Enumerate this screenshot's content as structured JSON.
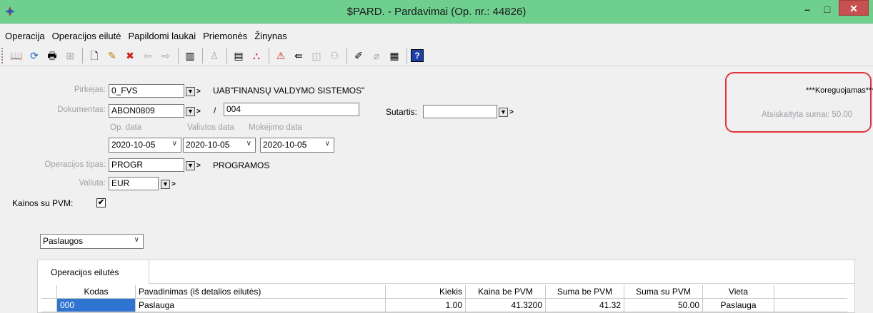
{
  "window": {
    "title": "$PARD. - Pardavimai (Op. nr.: 44826)",
    "min": "–",
    "max": "□",
    "close": "✕"
  },
  "menu": [
    "Operacija",
    "Operacijos eilutė",
    "Papildomi laukai",
    "Priemonės",
    "Žinynas"
  ],
  "form": {
    "buyer_label": "Pirkėjas:",
    "buyer_code": "0_FVS",
    "buyer_name": "UAB\"FINANSŲ VALDYMO SISTEMOS\"",
    "doc_label": "Dokumentas:",
    "doc_series": "ABON0809",
    "doc_slash": "/",
    "doc_number": "004",
    "contract_label": "Sutartis:",
    "contract_value": "",
    "op_date_label": "Op. data",
    "currency_date_label": "Valiutos data",
    "payment_date_label": "Mokėjimo data",
    "op_date": "2020-10-05",
    "currency_date": "2020-10-05",
    "payment_date": "2020-10-05",
    "op_type_label": "Operacijos tipas:",
    "op_type_code": "PROGR",
    "op_type_name": "PROGRAMOS",
    "currency_label": "Valiuta:",
    "currency_code": "EUR",
    "prices_vat_label": "Kainos su PVM:",
    "prices_vat_checked": "✔",
    "category_select": "Paslaugos"
  },
  "status": {
    "state": "***Koreguojamas***",
    "settled": "Atsiskaityta sumai: 50.00",
    "highlight_color": "#e0353d"
  },
  "tabs": [
    "Operacijos eilutės"
  ],
  "table": {
    "headers": [
      "",
      "Kodas",
      "Pavadinimas (iš detalios eilutės)",
      "Kiekis",
      "Kaina be PVM",
      "Suma be PVM",
      "Suma su PVM",
      "Vieta",
      ""
    ],
    "rows": [
      [
        "",
        "000",
        "Paslauga",
        "1.00",
        "41.3200",
        "41.32",
        "50.00",
        "Paslauga",
        ""
      ]
    ]
  }
}
